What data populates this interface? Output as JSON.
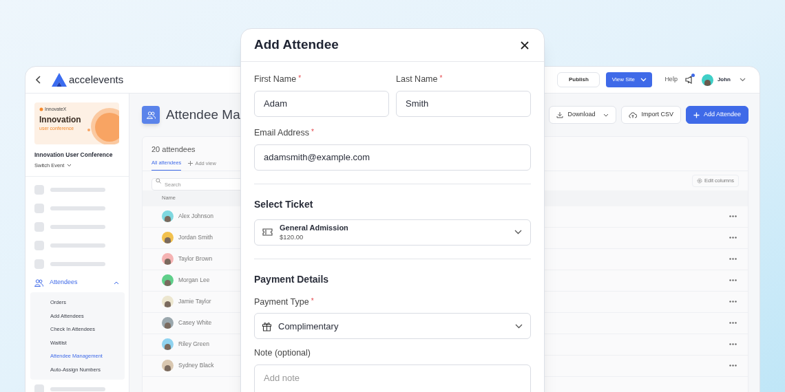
{
  "header": {
    "brand": "accelevents",
    "publish": "Publish",
    "view_site": "View Site",
    "help": "Help",
    "notification": true,
    "user": "John"
  },
  "sidebar": {
    "event": {
      "banner": {
        "brand": "InnovateX",
        "title": "Innovation",
        "subtitle": "user conference"
      },
      "name": "Innovation User Conference",
      "switch": "Switch Event"
    },
    "section": {
      "label": "Attendees",
      "expanded": true,
      "items": [
        {
          "label": "Orders",
          "selected": false
        },
        {
          "label": "Add Attendees",
          "selected": false
        },
        {
          "label": "Check In Attendees",
          "selected": false
        },
        {
          "label": "Waitlist",
          "selected": false
        },
        {
          "label": "Attendee Management",
          "selected": true
        },
        {
          "label": "Auto-Assign Numbers",
          "selected": false
        }
      ]
    }
  },
  "page": {
    "title": "Attendee Ma",
    "buttons": [
      {
        "label": "Download",
        "kind": "download"
      },
      {
        "label": "Import CSV",
        "kind": "import"
      },
      {
        "label": "Add Attendee",
        "kind": "add"
      }
    ],
    "count": "20 attendees",
    "views": [
      {
        "label": "All attendees",
        "selected": true
      }
    ],
    "add_view": "Add view",
    "search": {
      "placeholder": "Search"
    },
    "edit_columns": "Edit columns",
    "columns": [
      "Name"
    ],
    "rows": [
      {
        "name": "Alex Johnson",
        "color": "#7fd8e0"
      },
      {
        "name": "Jordan Smith",
        "color": "#f2c14e"
      },
      {
        "name": "Taylor Brown",
        "color": "#f5b3b3"
      },
      {
        "name": "Morgan Lee",
        "color": "#5fcf8a"
      },
      {
        "name": "Jamie Taylor",
        "color": "#ece6cf"
      },
      {
        "name": "Casey White",
        "color": "#9aa7ad"
      },
      {
        "name": "Riley Green",
        "color": "#8fd3f0"
      },
      {
        "name": "Sydney Black",
        "color": "#d9c7b0"
      }
    ]
  },
  "modal": {
    "title": "Add Attendee",
    "first_name": {
      "label": "First Name",
      "mark": "*",
      "value": "Adam"
    },
    "last_name": {
      "label": "Last Name",
      "mark": "*",
      "value": "Smith"
    },
    "email": {
      "label": "Email Address",
      "mark": "*",
      "value": "adamsmith@example.com"
    },
    "ticket": {
      "heading": "Select Ticket",
      "name": "General Admission",
      "price": "$120.00"
    },
    "payment": {
      "heading": "Payment Details",
      "label": "Payment Type",
      "mark": "*",
      "value": "Complimentary"
    },
    "note": {
      "label": "Note (optional)",
      "placeholder": "Add note"
    }
  }
}
